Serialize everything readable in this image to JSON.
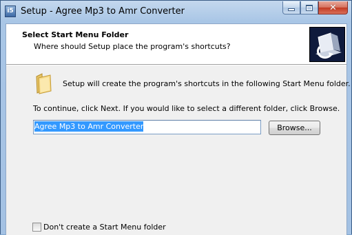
{
  "window": {
    "title": "Setup - Agree Mp3 to Amr Converter",
    "app_icon_text": "i5"
  },
  "header": {
    "title": "Select Start Menu Folder",
    "subtitle": "Where should Setup place the program's shortcuts?"
  },
  "content": {
    "intro": "Setup will create the program's shortcuts in the following Start Menu folder.",
    "instructions": "To continue, click Next. If you would like to select a different folder, click Browse.",
    "folder_value": "Agree Mp3 to Amr Converter",
    "browse_label": "Browse...",
    "no_folder_label": "Don't create a Start Menu folder",
    "no_folder_checked": false
  },
  "icons": {
    "app": "setup-app-icon",
    "folder": "folder-icon",
    "wizard": "computer-install-icon",
    "minimize": "minimize-icon",
    "maximize": "maximize-icon",
    "close": "close-icon"
  }
}
